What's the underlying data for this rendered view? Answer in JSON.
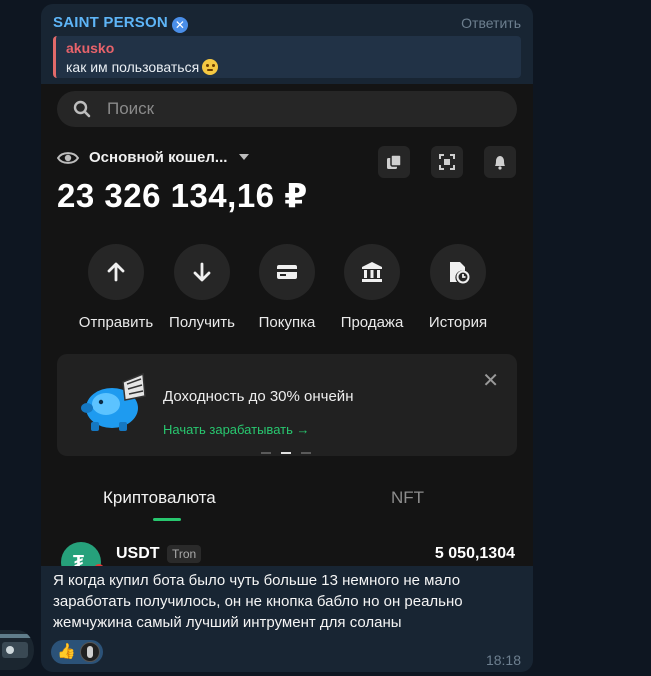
{
  "message": {
    "sender": "SAINT PERSON",
    "reply_button": "Ответить",
    "quote": {
      "author": "akusko",
      "text": "как им пользоваться"
    },
    "text": "Я когда купил бота было чуть больше 13 немного не мало заработать получилось, он не кнопка бабло но он реально жемчужина самый лучший интрумент для соланы",
    "time": "18:18",
    "reactions": [
      "thumbs-up",
      "user-avatar"
    ]
  },
  "wallet_screenshot": {
    "search_placeholder": "Поиск",
    "wallet_name": "Основной кошел...",
    "balance": "23 326 134,16 ₽",
    "actions": [
      {
        "label": "Отправить",
        "icon": "arrow-up-icon"
      },
      {
        "label": "Получить",
        "icon": "arrow-down-icon"
      },
      {
        "label": "Покупка",
        "icon": "card-icon"
      },
      {
        "label": "Продажа",
        "icon": "bank-icon"
      },
      {
        "label": "История",
        "icon": "history-icon"
      }
    ],
    "promo": {
      "title": "Доходность до 30% ончейн",
      "link": "Начать зарабатывать",
      "link_arrow": "→",
      "close": "✕"
    },
    "tabs": {
      "crypto": "Криптовалюта",
      "nft": "NFT"
    },
    "asset": {
      "name": "USDT",
      "network": "Tron",
      "value": "5 050,1304"
    }
  },
  "colors": {
    "chat_bg": "#0e1621",
    "bubble_bg": "#182533",
    "sender": "#5eb5f7",
    "quote_author": "#e8636b",
    "accent_green": "#28c76f"
  }
}
